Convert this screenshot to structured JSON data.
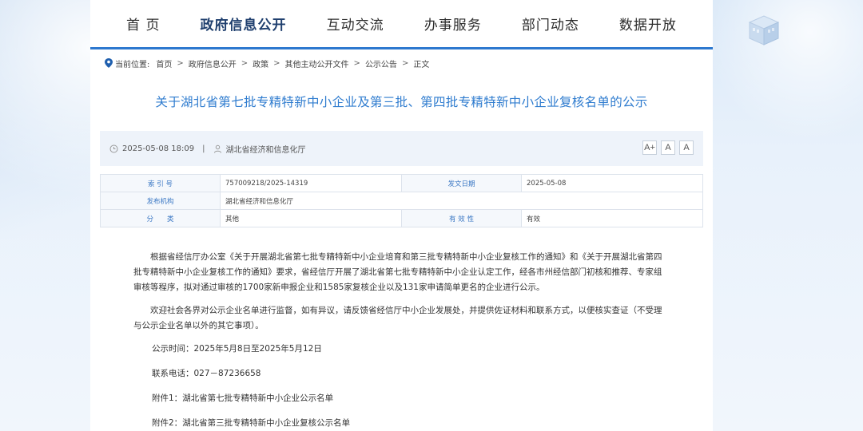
{
  "nav": {
    "items": [
      "首 页",
      "政府信息公开",
      "互动交流",
      "办事服务",
      "部门动态",
      "数据开放"
    ],
    "active_index": 1
  },
  "breadcrumb": {
    "label": "当前位置:",
    "items": [
      "首页",
      "政府信息公开",
      "政策",
      "其他主动公开文件",
      "公示公告",
      "正文"
    ],
    "separator": ">"
  },
  "article": {
    "title": "关于湖北省第七批专精特新中小企业及第三批、第四批专精特新中小企业复核名单的公示",
    "datetime": "2025-05-08 18:09",
    "divider": "|",
    "source": "湖北省经济和信息化厅",
    "font_buttons": [
      "A+",
      "A",
      "A"
    ]
  },
  "info_table": {
    "rows": [
      {
        "label1": "索 引 号",
        "value1": "757009218/2025-14319",
        "label2": "发文日期",
        "value2": "2025-05-08"
      },
      {
        "label1": "发布机构",
        "value1": "湖北省经济和信息化厅",
        "label2": "",
        "value2": ""
      },
      {
        "label1": "分　　类",
        "value1": "其他",
        "label2": "有 效 性",
        "value2": "有效"
      }
    ]
  },
  "body": {
    "p1": "根据省经信厅办公室《关于开展湖北省第七批专精特新中小企业培育和第三批专精特新中小企业复核工作的通知》和《关于开展湖北省第四批专精特新中小企业复核工作的通知》要求，省经信厅开展了湖北省第七批专精特新中小企业认定工作，经各市州经信部门初核和推荐、专家组审核等程序，拟对通过审核的1700家新申报企业和1585家复核企业以及131家申请简单更名的企业进行公示。",
    "p2": "欢迎社会各界对公示企业名单进行监督，如有异议，请反馈省经信厅中小企业发展处，并提供佐证材料和联系方式，以便核实查证（不受理与公示企业名单以外的其它事项）。",
    "period": "公示时间：2025年5月8日至2025年5月12日",
    "phone": "联系电话：027－87236658",
    "attachment1": "附件1：湖北省第七批专精特新中小企业公示名单",
    "attachment2": "附件2：湖北省第三批专精特新中小企业复核公示名单"
  },
  "colors": {
    "accent": "#2d78cf",
    "title": "#2f7ccf",
    "label": "#3a77c4"
  }
}
